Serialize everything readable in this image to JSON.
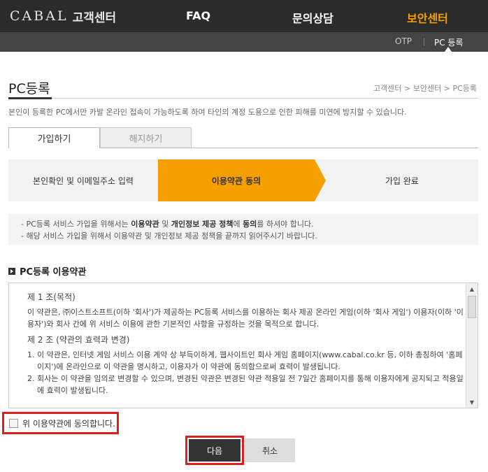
{
  "header": {
    "logo_text": "CABAL",
    "logo_sub": "고객센터",
    "nav": [
      {
        "label": "FAQ"
      },
      {
        "label": "문의상담"
      },
      {
        "label": "보안센터"
      }
    ],
    "accent_color": "#f5a000"
  },
  "subnav": {
    "items": [
      {
        "label": "OTP"
      },
      {
        "label": "PC 등록"
      }
    ]
  },
  "page": {
    "title": "PC등록",
    "breadcrumb": "고객센터 > 보안센터 > PC등록",
    "description": "본인이 등록한 PC에서만 카발 온라인 접속이 가능하도록 하여 타인의 계정 도용으로 인한 피해를 미연에 방지할 수 있습니다."
  },
  "tabs": [
    {
      "label": "가입하기"
    },
    {
      "label": "해지하기"
    }
  ],
  "steps": [
    {
      "label": "본인확인 및 이메일주소 입력"
    },
    {
      "label": "이용약관 동의"
    },
    {
      "label": "가입 완료"
    }
  ],
  "notice": {
    "line1_pre": "- PC등록 서비스 가입을 위해서는 ",
    "line1_b1": "이용약관",
    "line1_mid1": " 및 ",
    "line1_b2": "개인정보 제공 정책",
    "line1_mid2": "에 ",
    "line1_b3": "동의",
    "line1_post": "를 하셔야 합니다.",
    "line2": "- 해당 서비스 가입을 위해서 이용약관 및 개인정보 제공 정책을 끝까지 읽어주시기 바랍니다."
  },
  "terms": {
    "heading": "PC등록 이용약관",
    "art1_title": "제 1 조(목적)",
    "art1_body": "이 약관은, ㈜이스트소프트(이하 '회사')가 제공하는 PC등록 서비스를 이용하는 회사 제공 온라인 게임(이하 '회사 게임') 이용자(이하 '이용자')와 회사 간에 위 서비스 이용에 관한 기본적인 사항을 규정하는 것을 목적으로 합니다.",
    "art2_title": "제 2 조 (약관의 효력과 변경)",
    "art2_items": [
      {
        "num": "1.",
        "text": "이 약관은, 인터넷 게임 서비스 이용 계약 상 부득이하게, 웹사이트인 회사 게임 홈페이지(www.cabal.co.kr 등, 이하 총칭하여 '홈페이지')에 온라인으로 이 약관을 명시하고, 이용자가 이 약관에 동의함으로써 효력이 발생됩니다."
      },
      {
        "num": "2.",
        "text": "회사는 이 약관을 임의로 변경할 수 있으며, 변경된 약관은 변경된 약관 적용일 전 7일간 홈페이지를 통해 이용자에게 공지되고 적용일에 효력이 발생됩니다."
      }
    ]
  },
  "agree": {
    "label": "위 이용약관에 동의합니다."
  },
  "buttons": {
    "next": "다음",
    "cancel": "취소"
  }
}
